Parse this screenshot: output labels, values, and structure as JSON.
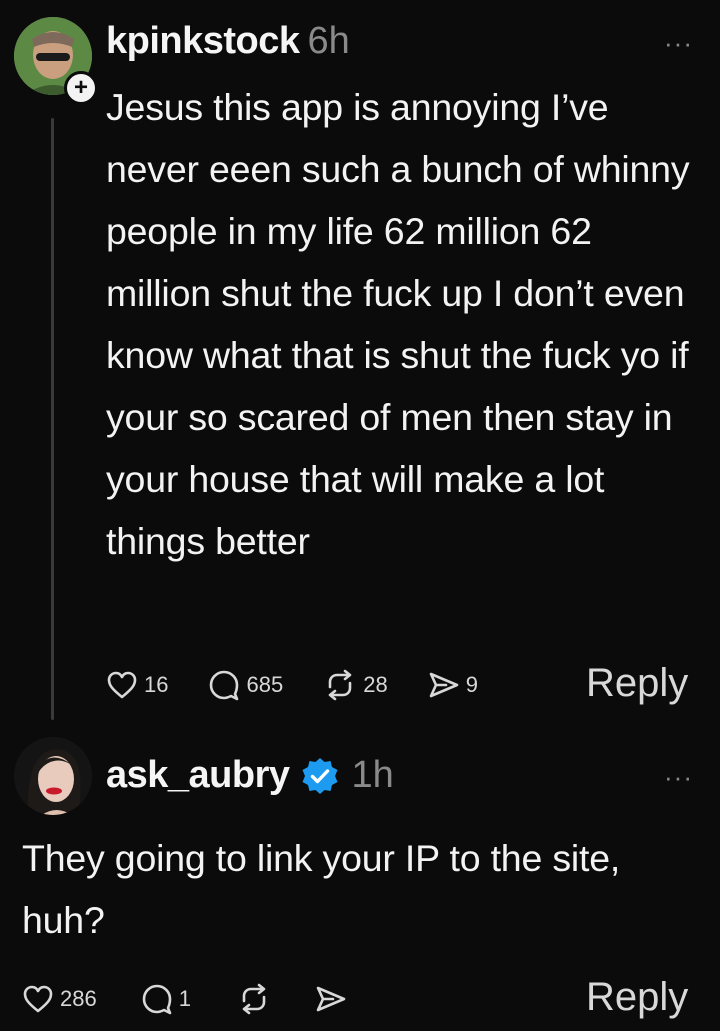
{
  "post1": {
    "username": "kpinkstock",
    "time": "6h",
    "more": "···",
    "body": "Jesus this app is annoying I’ve never eeen such a bunch of whinny people in my life 62 million 62 million shut the fuck up I don’t even know what that is shut the fuck yo if your so scared of men then stay in your house that will make a lot things better",
    "likes": "16",
    "comments": "685",
    "reposts": "28",
    "shares": "9",
    "reply_label": "Reply",
    "follow_badge": "+"
  },
  "post2": {
    "username": "ask_aubry",
    "time": "1h",
    "more": "···",
    "verified": true,
    "body": "They going to link your IP to the site, huh?",
    "likes": "286",
    "comments": "1",
    "reply_label": "Reply"
  },
  "icons": [
    "heart-icon",
    "comment-icon",
    "repost-icon",
    "share-icon",
    "verified-badge-icon",
    "more-icon",
    "follow-plus-icon"
  ],
  "colors": {
    "background": "#0b0b0b",
    "text": "#f3f3f3",
    "muted": "#8a8a8a",
    "verified": "#1d9bf0"
  }
}
